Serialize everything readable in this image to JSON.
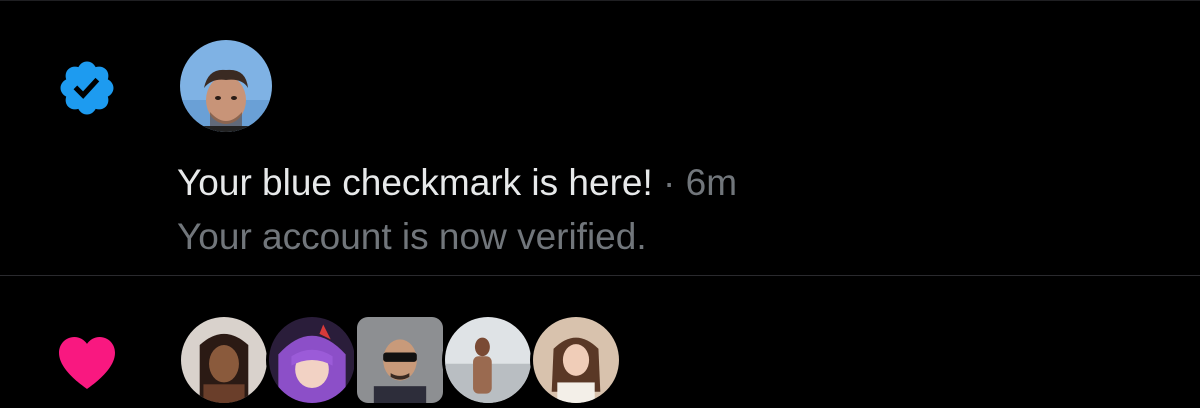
{
  "notifications": [
    {
      "type": "verification",
      "icon": "verified-badge-icon",
      "icon_color": "#1d9bf0",
      "title": "Your blue checkmark is here!",
      "separator": "·",
      "time": "6m",
      "body": "Your account is now verified."
    },
    {
      "type": "like",
      "icon": "heart-icon",
      "icon_color": "#f91880",
      "avatar_count": 5
    }
  ],
  "colors": {
    "background": "#000000",
    "primary_text": "#e7e9ea",
    "secondary_text": "#71767b",
    "divider": "#2a2a2e"
  }
}
